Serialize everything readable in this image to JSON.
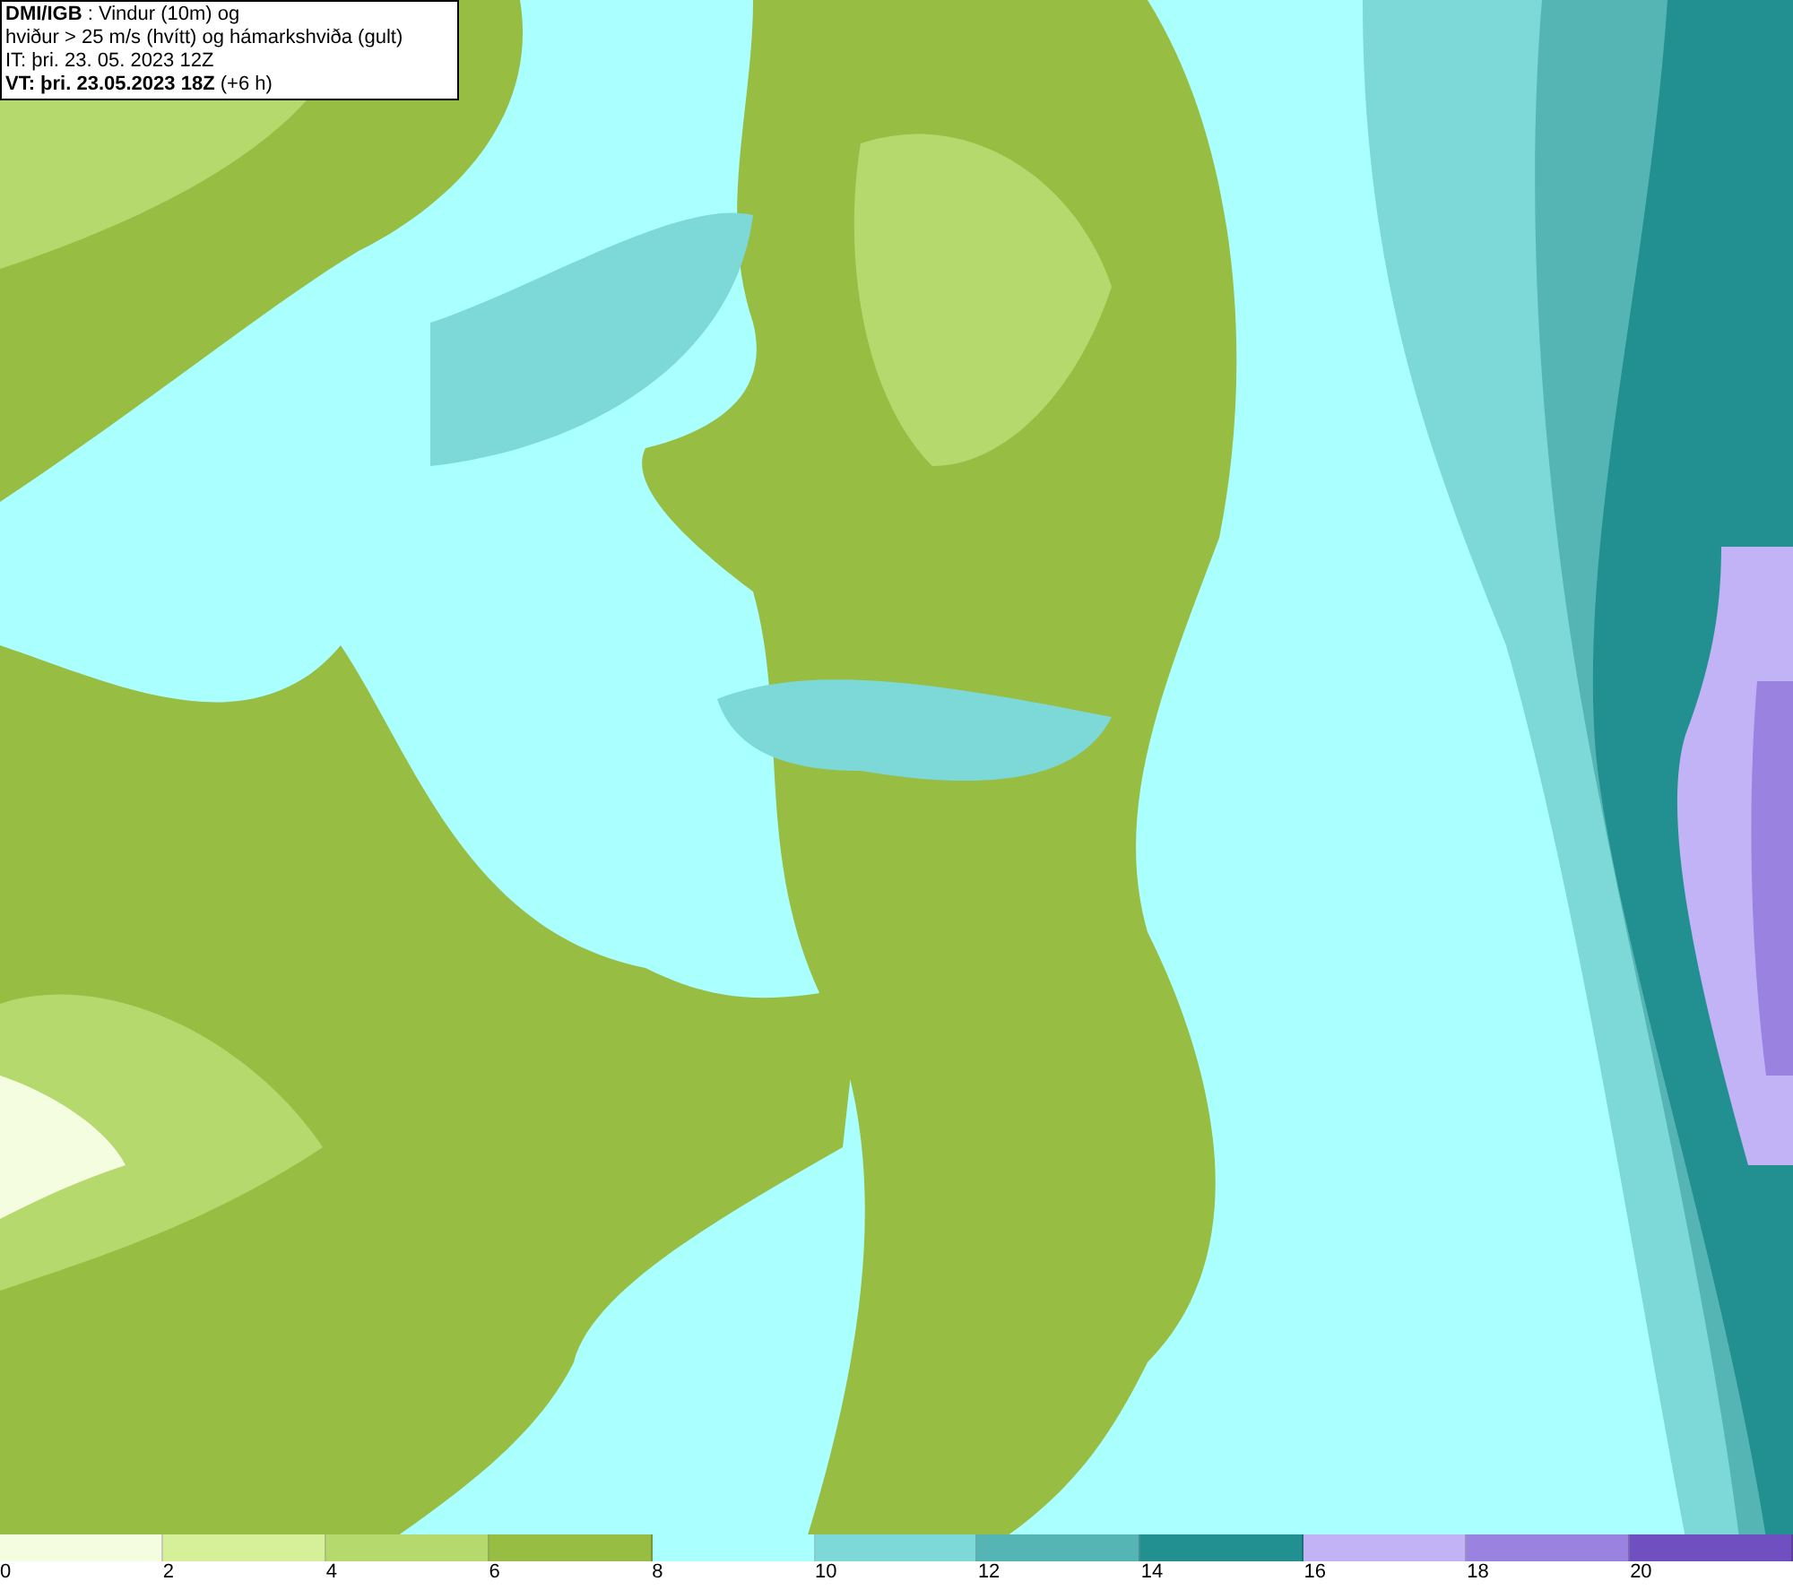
{
  "header": {
    "lines": [
      "**DMI/IGB** : Vindur (10m) og",
      "hviður > 25 m/s (hvítt) og hámarkshviða (gult)",
      "IT: þri. 23. 05. 2023 12Z",
      "**VT: þri. 23.05.2023 18Z** (+6 h)"
    ]
  },
  "legend": [
    {
      "label": "0",
      "color": "#f5fde0"
    },
    {
      "label": "2",
      "color": "#d6f09a"
    },
    {
      "label": "4",
      "color": "#b5d96c"
    },
    {
      "label": "6",
      "color": "#97bd42"
    },
    {
      "label": "8",
      "color": "#aaffff"
    },
    {
      "label": "10",
      "color": "#7dd8d8"
    },
    {
      "label": "12",
      "color": "#55b5b5"
    },
    {
      "label": "14",
      "color": "#229090"
    },
    {
      "label": "16",
      "color": "#c2b3f7"
    },
    {
      "label": "18",
      "color": "#9a82e0"
    },
    {
      "label": "20",
      "color": "#7050c0"
    }
  ]
}
